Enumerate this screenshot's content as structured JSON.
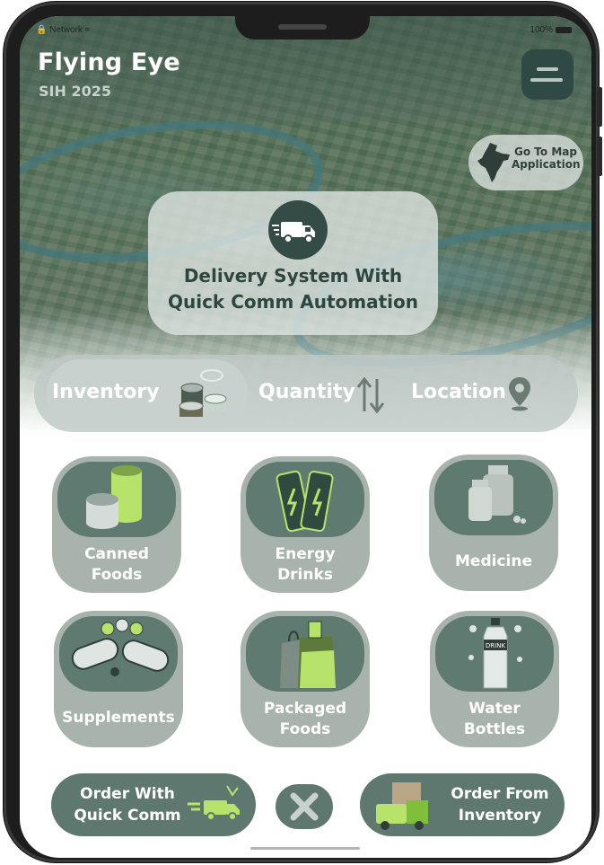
{
  "status_bar": {
    "carrier": "Network",
    "battery": "100%"
  },
  "header": {
    "title": "Flying Eye",
    "subtitle": "SIH 2025",
    "menu_icon": "hamburger-menu-icon"
  },
  "map_button": {
    "label_line1": "Go To Map",
    "label_line2": "Application",
    "icon": "india-map-icon"
  },
  "delivery_card": {
    "icon": "delivery-truck-icon",
    "line1": "Delivery System With",
    "line2": "Quick Comm Automation"
  },
  "tabs": [
    {
      "label": "Inventory",
      "icon": "cans-icon",
      "active": true
    },
    {
      "label": "Quantity",
      "icon": "sort-arrows-icon",
      "active": false
    },
    {
      "label": "Location",
      "icon": "location-pin-icon",
      "active": false
    }
  ],
  "categories": [
    {
      "line1": "Canned",
      "line2": "Foods",
      "icon": "canned-food-icon"
    },
    {
      "line1": "Energy",
      "line2": "Drinks",
      "icon": "energy-drink-icon"
    },
    {
      "line1": "Medicine",
      "line2": "",
      "icon": "medicine-bottles-icon"
    },
    {
      "line1": "Supplements",
      "line2": "",
      "icon": "supplement-pills-icon"
    },
    {
      "line1": "Packaged",
      "line2": "Foods",
      "icon": "grocery-bag-icon"
    },
    {
      "line1": "Water",
      "line2": "Bottles",
      "icon": "water-bottle-icon"
    }
  ],
  "actions": {
    "quick_comm": {
      "line1": "Order With",
      "line2": "Quick Comm",
      "icon": "fast-truck-icon"
    },
    "close_icon": "close-icon",
    "inventory": {
      "line1": "Order From",
      "line2": "Inventory",
      "icon": "inventory-truck-icon"
    }
  },
  "colors": {
    "accent_dark": "#354c46",
    "card_outer": "#a9b3ae",
    "card_inner": "#5f7a70",
    "lime": "#b7e36a"
  }
}
